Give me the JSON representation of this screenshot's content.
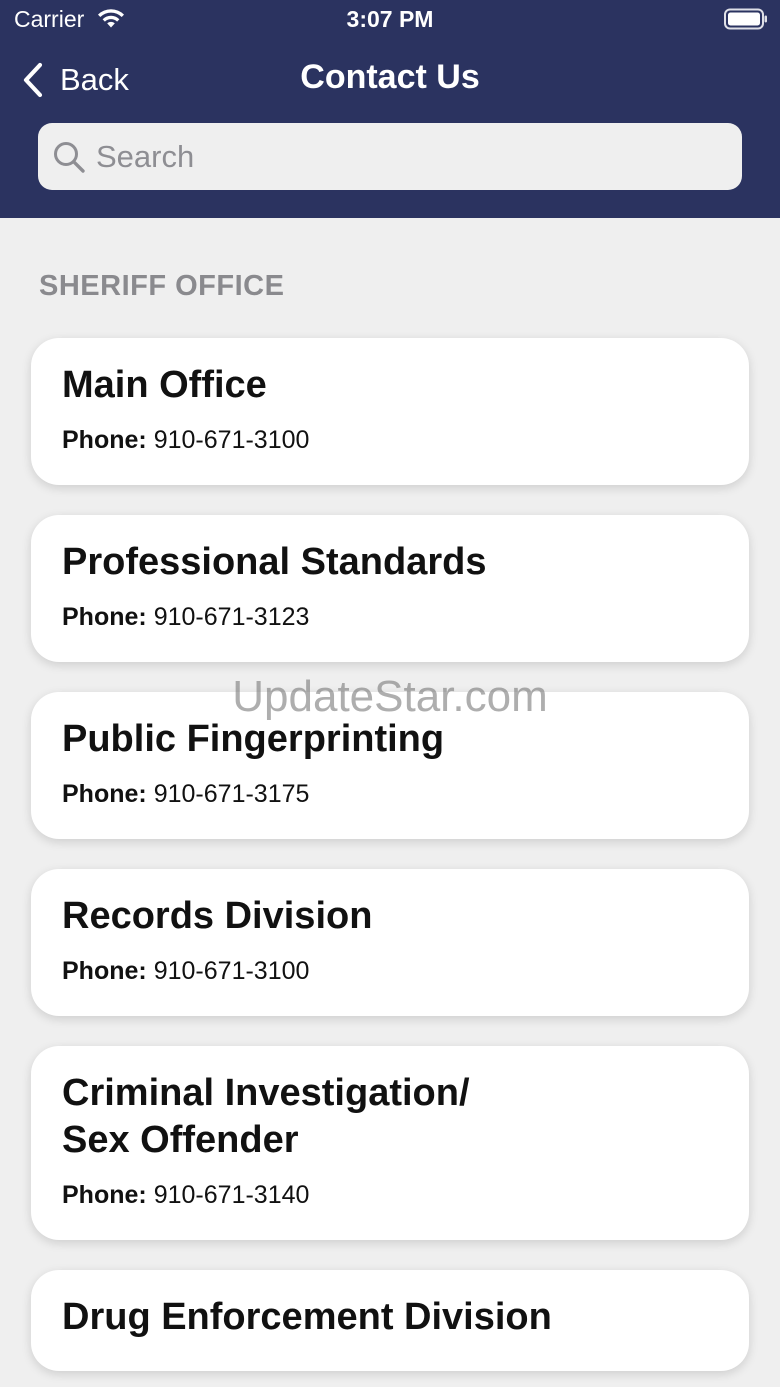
{
  "status_bar": {
    "carrier": "Carrier",
    "time": "3:07 PM"
  },
  "nav": {
    "back_label": "Back",
    "title": "Contact Us"
  },
  "search": {
    "placeholder": "Search",
    "value": ""
  },
  "section": {
    "title": "SHERIFF OFFICE"
  },
  "contacts": [
    {
      "name_lines": [
        "Main Office"
      ],
      "phone_label": "Phone:",
      "phone": "910-671-3100"
    },
    {
      "name_lines": [
        "Professional Standards"
      ],
      "phone_label": "Phone:",
      "phone": "910-671-3123"
    },
    {
      "name_lines": [
        "Public Fingerprinting"
      ],
      "phone_label": "Phone:",
      "phone": "910-671-3175"
    },
    {
      "name_lines": [
        "Records Division"
      ],
      "phone_label": "Phone:",
      "phone": "910-671-3100"
    },
    {
      "name_lines": [
        "Criminal Investigation/",
        "Sex Offender"
      ],
      "phone_label": "Phone:",
      "phone": "910-671-3140"
    },
    {
      "name_lines": [
        "Drug Enforcement Division"
      ],
      "phone_label": "Phone:",
      "phone": ""
    }
  ],
  "watermark": "UpdateStar.com",
  "colors": {
    "header_bg": "#2b3360",
    "page_bg": "#efefef",
    "card_bg": "#ffffff",
    "section_header": "#8a8a8e"
  },
  "icons": {
    "wifi": "wifi-icon",
    "battery": "battery-icon",
    "back": "back-chevron-icon",
    "search": "search-icon"
  }
}
